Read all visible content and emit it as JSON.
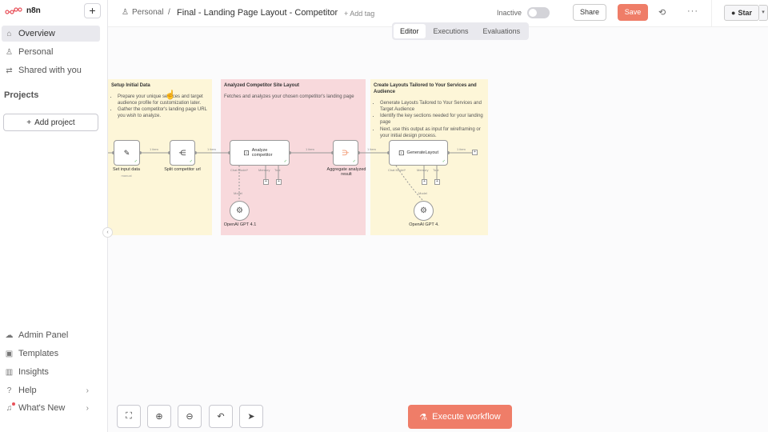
{
  "app": {
    "name": "n8n"
  },
  "sidebar": {
    "items": [
      {
        "label": "Overview",
        "icon": "home-icon"
      },
      {
        "label": "Personal",
        "icon": "user-icon"
      },
      {
        "label": "Shared with you",
        "icon": "share-icon"
      }
    ],
    "projects_title": "Projects",
    "add_project": "Add project",
    "bottom": [
      {
        "label": "Admin Panel",
        "icon": "cloud-icon"
      },
      {
        "label": "Templates",
        "icon": "box-icon"
      },
      {
        "label": "Insights",
        "icon": "chart-icon"
      },
      {
        "label": "Help",
        "icon": "help-icon"
      },
      {
        "label": "What's New",
        "icon": "bell-icon"
      }
    ]
  },
  "header": {
    "breadcrumb": "Personal",
    "separator": "/",
    "title": "Final - Landing Page Layout - Competitor",
    "add_tag": "+ Add tag",
    "status": "Inactive",
    "share": "Share",
    "save": "Save",
    "star": "Star"
  },
  "tabs": [
    "Editor",
    "Executions",
    "Evaluations"
  ],
  "canvas": {
    "stickies": [
      {
        "title": "Setup Initial Data",
        "bullets": [
          "Prepare your unique services and target audience profile for customization later.",
          "Gather the competitor's landing page URL you wish to analyze."
        ]
      },
      {
        "title": "Analyzed Competitor Site Layout",
        "bullets": [
          "Fetches and analyzes your chosen competitor's landing page"
        ]
      },
      {
        "title": "Create Layouts Tailored to Your Services and Audience",
        "bullets": [
          "Generate Layouts Tailored to Your Services and Target Audience",
          "Identify the key sections needed for your landing page",
          "Next, use this output as input for wireframing or your initial design process."
        ]
      }
    ],
    "nodes": {
      "set_input": "Set input data",
      "set_input_sub": "manual",
      "split": "Split competitor url",
      "analyze": "Analyze competitor",
      "aggregate": "Aggregate analyzed result",
      "generate": "GenerateLayout",
      "openai1": "OpenAI GPT 4.1",
      "openai2": "OpenAI GPT 4."
    },
    "wire_labels": {
      "item1": "1 item",
      "item2": "1 item",
      "item3": "1 item",
      "item4": "1 item",
      "item5": "1 item"
    },
    "ports": {
      "chat_model": "Chat Model*",
      "memory": "Memory",
      "tool": "Tool",
      "model": "Model"
    }
  },
  "controls": {
    "execute": "Execute workflow"
  }
}
